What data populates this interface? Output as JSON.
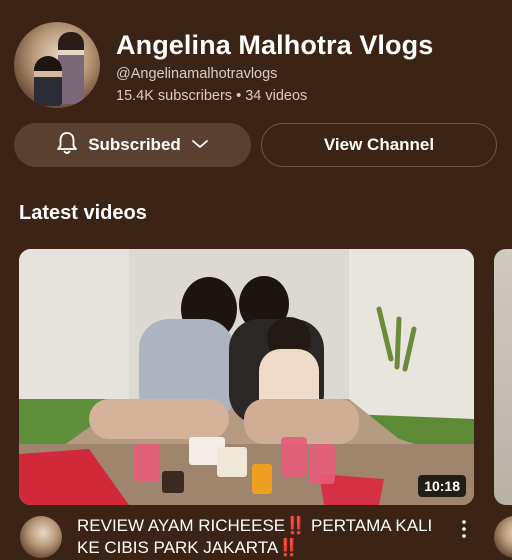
{
  "channel": {
    "name": "Angelina Malhotra Vlogs",
    "handle": "@Angelinamalhotravlogs",
    "subscribers": "15.4K subscribers",
    "separator": "•",
    "videos": "34 videos"
  },
  "actions": {
    "subscribed_label": "Subscribed",
    "view_channel_label": "View Channel"
  },
  "section": {
    "title": "Latest videos"
  },
  "video": {
    "title": "REVIEW AYAM RICHEESE‼️ PERTAMA KALI KE CIBIS PARK JAKARTA‼️",
    "duration": "10:18"
  },
  "colors": {
    "background": "#3b2416",
    "subscribed_button": "#5a4030",
    "text_secondary": "#d9ccc3"
  },
  "icons": {
    "bell": "bell-icon",
    "chevron": "chevron-down-icon",
    "more": "more-vert-icon"
  }
}
